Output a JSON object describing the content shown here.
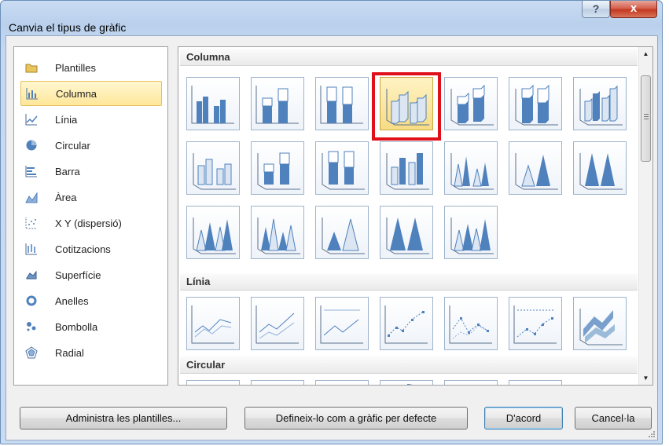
{
  "window": {
    "title": "Canvia el tipus de gràfic",
    "help_label": "?",
    "close_label": "x"
  },
  "categories": [
    {
      "label": "Plantilles",
      "icon": "folder-icon"
    },
    {
      "label": "Columna",
      "icon": "column-chart-icon",
      "selected": true
    },
    {
      "label": "Línia",
      "icon": "line-chart-icon"
    },
    {
      "label": "Circular",
      "icon": "pie-chart-icon"
    },
    {
      "label": "Barra",
      "icon": "bar-chart-icon"
    },
    {
      "label": "Àrea",
      "icon": "area-chart-icon"
    },
    {
      "label": "X Y (dispersió)",
      "icon": "scatter-chart-icon"
    },
    {
      "label": "Cotitzacions",
      "icon": "stock-chart-icon"
    },
    {
      "label": "Superfície",
      "icon": "surface-chart-icon"
    },
    {
      "label": "Anelles",
      "icon": "doughnut-chart-icon"
    },
    {
      "label": "Bombolla",
      "icon": "bubble-chart-icon"
    },
    {
      "label": "Radial",
      "icon": "radar-chart-icon"
    }
  ],
  "gallery": {
    "sections": [
      "Columna",
      "Línia",
      "Circular"
    ],
    "selected_thumb": "3-D Clustered Column"
  },
  "buttons": {
    "manage_templates": "Administra les plantilles...",
    "set_default": "Defineix-lo com a gràfic per defecte",
    "ok": "D'acord",
    "cancel": "Cancel·la"
  },
  "colors": {
    "accent_red": "#e0101a",
    "selection": "#ffe79a",
    "chart_blue": "#4f81bd"
  }
}
